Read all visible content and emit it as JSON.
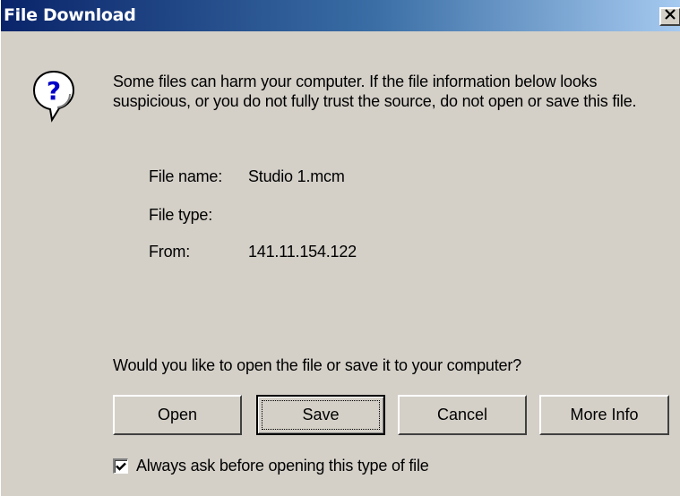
{
  "window": {
    "title": "File Download",
    "close_glyph": "×"
  },
  "message": {
    "icon": "question-icon",
    "text": "Some files can harm your computer. If the file information below looks suspicious, or you do not fully trust the source, do not open or save this file."
  },
  "file_info": {
    "name_label": "File name:",
    "name_value": "Studio 1.mcm",
    "type_label": "File type:",
    "type_value": "",
    "from_label": "From:",
    "from_value": "141.11.154.122"
  },
  "prompt": "Would you like to open the file or save it to your computer?",
  "buttons": {
    "open": "Open",
    "save": "Save",
    "cancel": "Cancel",
    "more_info": "More Info"
  },
  "checkbox": {
    "label": "Always ask before opening this type of file",
    "checked": true
  },
  "colors": {
    "title_start": "#0a246a",
    "title_end": "#a6caf0",
    "face": "#d4d0c8"
  }
}
